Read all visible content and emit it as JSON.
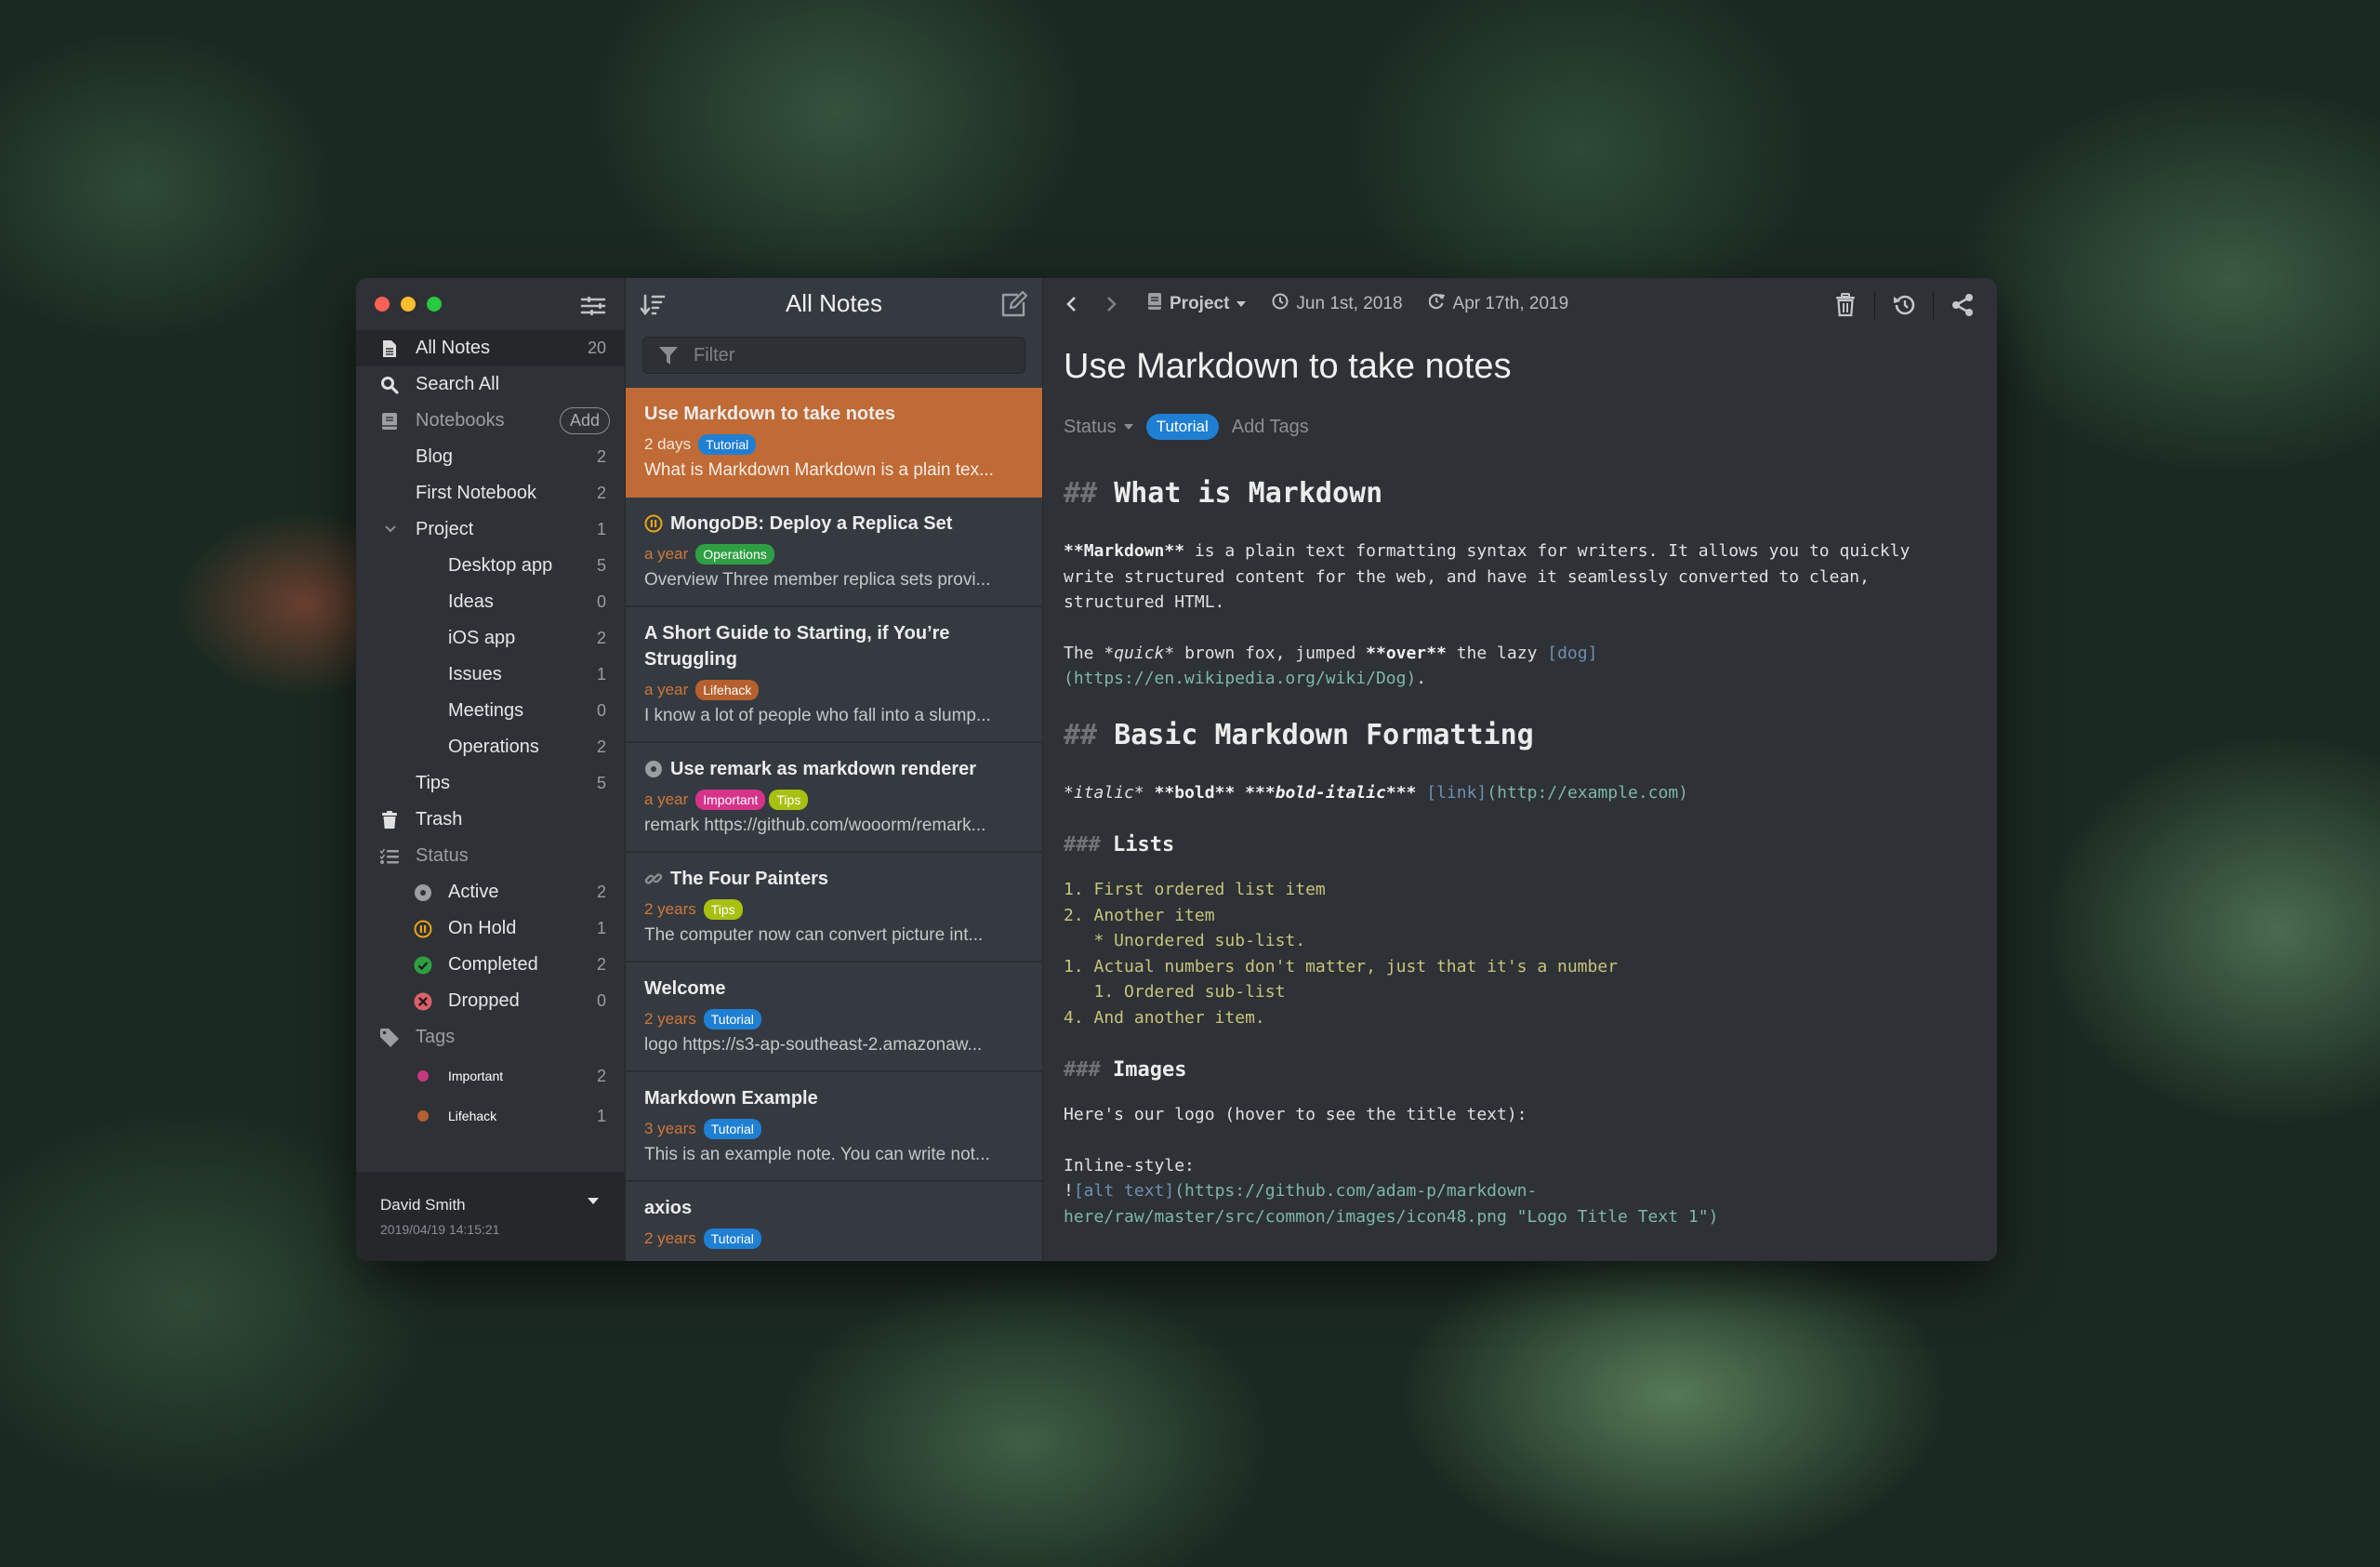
{
  "window": {
    "title": "All Notes"
  },
  "sidebar": {
    "all_notes": {
      "label": "All Notes",
      "count": "20"
    },
    "search_all": {
      "label": "Search All"
    },
    "notebooks": {
      "label": "Notebooks",
      "add_label": "Add"
    },
    "notebook_items": [
      {
        "label": "Blog",
        "count": "2"
      },
      {
        "label": "First Notebook",
        "count": "2"
      },
      {
        "label": "Project",
        "count": "1",
        "expanded": true
      },
      {
        "label": "Desktop app",
        "count": "5"
      },
      {
        "label": "Ideas",
        "count": "0"
      },
      {
        "label": "iOS app",
        "count": "2"
      },
      {
        "label": "Issues",
        "count": "1"
      },
      {
        "label": "Meetings",
        "count": "0"
      },
      {
        "label": "Operations",
        "count": "2"
      },
      {
        "label": "Tips",
        "count": "5"
      }
    ],
    "trash": {
      "label": "Trash"
    },
    "status": {
      "label": "Status",
      "items": [
        {
          "label": "Active",
          "count": "2",
          "icon": "active-icon",
          "color": "#a0a0a0"
        },
        {
          "label": "On Hold",
          "count": "1",
          "icon": "pause-icon",
          "color": "#e8a317"
        },
        {
          "label": "Completed",
          "count": "2",
          "icon": "check-icon",
          "color": "#2ea043"
        },
        {
          "label": "Dropped",
          "count": "0",
          "icon": "x-icon",
          "color": "#d9626a"
        }
      ]
    },
    "tags": {
      "label": "Tags",
      "items": [
        {
          "label": "Important",
          "count": "2",
          "color": "#c6397f"
        },
        {
          "label": "Lifehack",
          "count": "1",
          "color": "#b5602e"
        }
      ]
    },
    "user": {
      "name": "David Smith",
      "timestamp": "2019/04/19 14:15:21"
    }
  },
  "notelist": {
    "title": "All Notes",
    "filter_placeholder": "Filter",
    "filter_value": "",
    "notes": [
      {
        "title": "Use Markdown to take notes",
        "date": "2 days",
        "tags": [
          {
            "label": "Tutorial",
            "color": "#1f7fd3"
          }
        ],
        "preview": "What is Markdown Markdown is a plain tex...",
        "selected": true,
        "status_icon": null
      },
      {
        "title": "MongoDB: Deploy a Replica Set",
        "date": "a year",
        "tags": [
          {
            "label": "Operations",
            "color": "#2ea043"
          }
        ],
        "preview": "Overview Three member replica sets provi...",
        "status_icon": "pause-icon"
      },
      {
        "title": "A Short Guide to Starting, if You’re Struggling",
        "date": "a year",
        "tags": [
          {
            "label": "Lifehack",
            "color": "#b5602e"
          }
        ],
        "preview": "I know a lot of people who fall into a slump...",
        "status_icon": null
      },
      {
        "title": "Use remark as markdown renderer",
        "date": "a year",
        "tags": [
          {
            "label": "Important",
            "color": "#d6338a"
          },
          {
            "label": "Tips",
            "color": "#a8c012"
          }
        ],
        "preview": "remark https://github.com/wooorm/remark...",
        "status_icon": "active-icon"
      },
      {
        "title": "The Four Painters",
        "date": "2 years",
        "tags": [
          {
            "label": "Tips",
            "color": "#a8c012"
          }
        ],
        "preview": "The computer now can convert picture int...",
        "status_icon": "link-icon"
      },
      {
        "title": "Welcome",
        "date": "2 years",
        "tags": [
          {
            "label": "Tutorial",
            "color": "#1f7fd3"
          }
        ],
        "preview": "logo https://s3-ap-southeast-2.amazonaw...",
        "status_icon": null
      },
      {
        "title": "Markdown Example",
        "date": "3 years",
        "tags": [
          {
            "label": "Tutorial",
            "color": "#1f7fd3"
          }
        ],
        "preview": "This is an example note. You can write not...",
        "status_icon": null
      },
      {
        "title": "axios",
        "date": "2 years",
        "tags": [
          {
            "label": "Tutorial",
            "color": "#1f7fd3"
          }
        ],
        "preview": "",
        "status_icon": null
      }
    ]
  },
  "editor": {
    "notebook": "Project",
    "created": "Jun 1st, 2018",
    "updated": "Apr 17th, 2019",
    "title": "Use Markdown to take notes",
    "status_label": "Status",
    "tag": "Tutorial",
    "add_tags_label": "Add Tags",
    "content": {
      "h_what": {
        "hash": "##",
        "text": "What is Markdown"
      },
      "p1": {
        "b_open": "**",
        "b_text": "Markdown",
        "b_close": "**",
        "rest": " is a plain text formatting syntax for writers. It allows you to quickly write structured content for the web, and have it seamlessly converted to clean, structured HTML."
      },
      "p2": {
        "a": "The ",
        "i_mark": "*",
        "i_text": "quick",
        "b": " brown fox, jumped ",
        "b_mark": "**",
        "b_text": "over",
        "c": " the lazy ",
        "link": "[dog]",
        "url": "(https://en.wikipedia.org/wiki/Dog)",
        "end": "."
      },
      "h_basic": {
        "hash": "##",
        "text": "Basic Markdown Formatting"
      },
      "fmt": {
        "italic": "italic",
        "bold": "bold",
        "bold_italic": "bold-italic",
        "link": "[link]",
        "url": "(http://example.com)"
      },
      "h_lists": {
        "hash": "###",
        "text": "Lists"
      },
      "list": [
        "1. First ordered list item",
        "2. Another item",
        "   * Unordered sub-list.",
        "1. Actual numbers don't matter, just that it's a number",
        "   1. Ordered sub-list",
        "4. And another item."
      ],
      "h_images": {
        "hash": "###",
        "text": "Images"
      },
      "p_logo": "Here's our logo (hover to see the title text):",
      "inline_label": "Inline-style:",
      "img": {
        "bang": "!",
        "alt": "[alt text]",
        "url": "(https://github.com/adam-p/markdown-here/raw/master/src/common/images/icon48.png \"Logo Title Text 1\")"
      }
    }
  }
}
